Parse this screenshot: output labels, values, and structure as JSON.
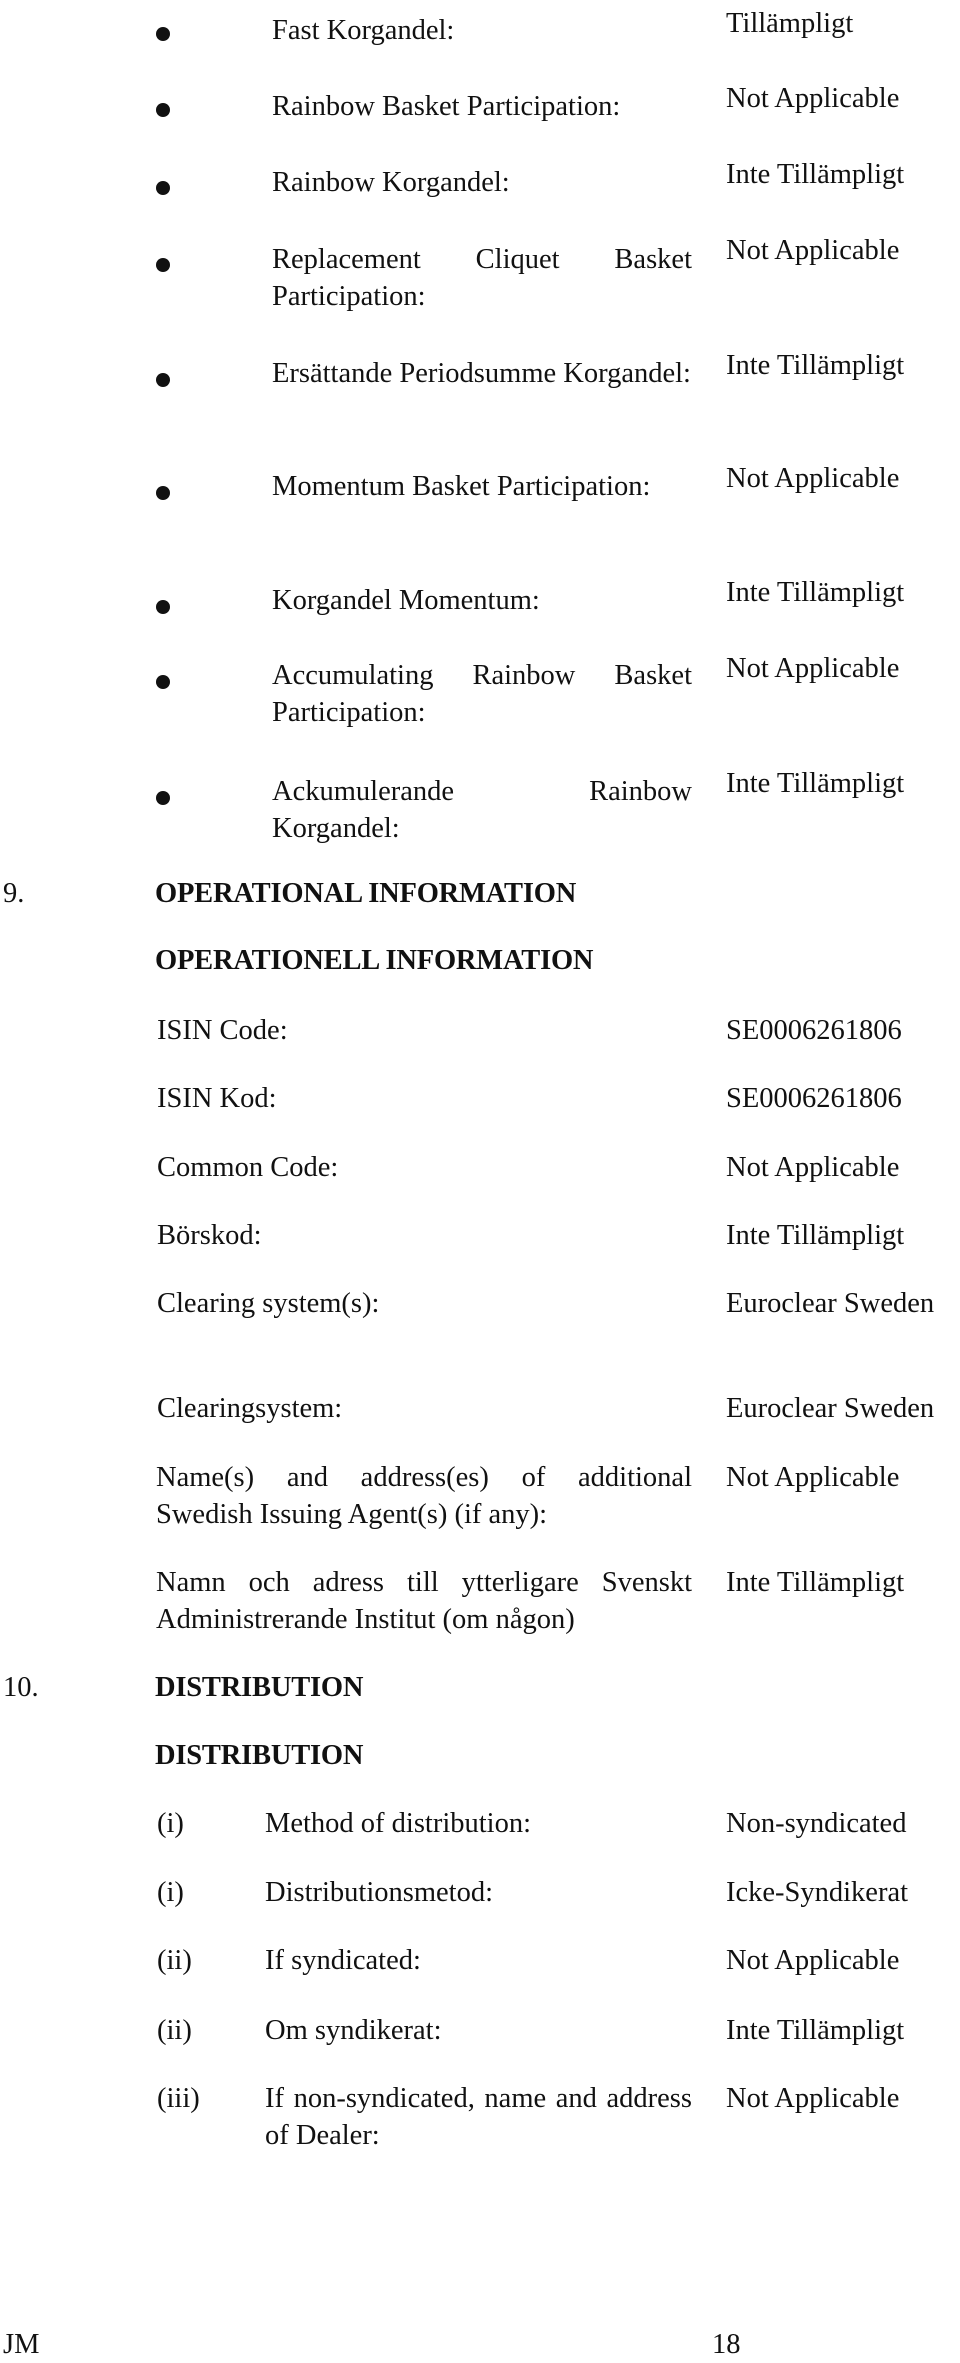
{
  "payoff_features": {
    "top_continuation_value": "Tillämpligt",
    "items": [
      {
        "label": "Fast Korgandel:",
        "value": ""
      },
      {
        "label": "Rainbow Basket Participation:",
        "value": "Not Applicable"
      },
      {
        "label": "Rainbow Korgandel:",
        "value": "Inte Tillämpligt"
      },
      {
        "label": "Replacement Cliquet Basket Participation:",
        "value": "Not Applicable"
      },
      {
        "label": "Ersättande Periodsumme Korgandel:",
        "value": "Inte Tillämpligt"
      },
      {
        "label": "Momentum Basket Participation:",
        "value": "Not Applicable"
      },
      {
        "label": "Korgandel Momentum:",
        "value": "Inte Tillämpligt"
      },
      {
        "label": "Accumulating Rainbow Basket Participation:",
        "value": "Not Applicable"
      },
      {
        "label": "Ackumulerande Rainbow Korgandel:",
        "value": "Inte Tillämpligt"
      }
    ]
  },
  "section9": {
    "number": "9.",
    "title": "OPERATIONAL INFORMATION",
    "title_sv": "OPERATIONELL INFORMATION",
    "rows": [
      {
        "label": "ISIN Code:",
        "value": "SE0006261806"
      },
      {
        "label": "ISIN Kod:",
        "value": "SE0006261806"
      },
      {
        "label": "Common Code:",
        "value": "Not Applicable"
      },
      {
        "label": "Börskod:",
        "value": "Inte Tillämpligt"
      },
      {
        "label": "Clearing system(s):",
        "value": "Euroclear Sweden"
      },
      {
        "label": "Clearingsystem:",
        "value": "Euroclear Sweden"
      },
      {
        "label": "Name(s) and address(es) of additional Swedish Issuing Agent(s) (if any):",
        "value": "Not Applicable"
      },
      {
        "label": "Namn och adress till ytterligare Svenskt Administrerande Institut (om någon)",
        "value": "Inte Tillämpligt"
      }
    ]
  },
  "section10": {
    "number": "10.",
    "title": "DISTRIBUTION",
    "title_sv": "DISTRIBUTION",
    "rows": [
      {
        "marker": "(i)",
        "label": "Method of distribution:",
        "value": "Non-syndicated"
      },
      {
        "marker": "(i)",
        "label": "Distributionsmetod:",
        "value": "Icke-Syndikerat"
      },
      {
        "marker": "(ii)",
        "label": "If syndicated:",
        "value": "Not Applicable"
      },
      {
        "marker": "(ii)",
        "label": "Om syndikerat:",
        "value": "Inte Tillämpligt"
      },
      {
        "marker": "(iii)",
        "label": "If non-syndicated, name and address of Dealer:",
        "value": "Not Applicable"
      }
    ]
  },
  "footer": {
    "left": "JM",
    "page_number": "18"
  }
}
